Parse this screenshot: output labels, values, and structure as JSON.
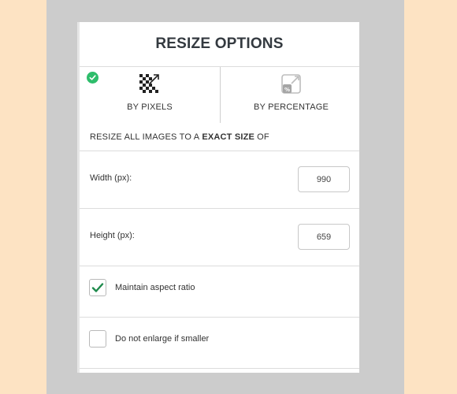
{
  "panel": {
    "title": "RESIZE OPTIONS"
  },
  "tabs": [
    {
      "label": "BY PIXELS",
      "icon": "pixels-resize-icon",
      "selected": true
    },
    {
      "label": "BY PERCENTAGE",
      "icon": "percentage-resize-icon",
      "selected": false
    }
  ],
  "subheader": {
    "prefix": "RESIZE ALL IMAGES TO A",
    "emphasis": "EXACT SIZE",
    "suffix": "OF"
  },
  "width": {
    "label": "Width (px):",
    "value": "990"
  },
  "height": {
    "label": "Height (px):",
    "value": "659"
  },
  "options": [
    {
      "label": "Maintain aspect ratio",
      "checked": true
    },
    {
      "label": "Do not enlarge if smaller",
      "checked": false
    }
  ],
  "colors": {
    "page_bg": "#fde3c3",
    "frame_bg": "#cccccc",
    "accent_green": "#2ebd6b",
    "check_green": "#1e8a4c"
  }
}
